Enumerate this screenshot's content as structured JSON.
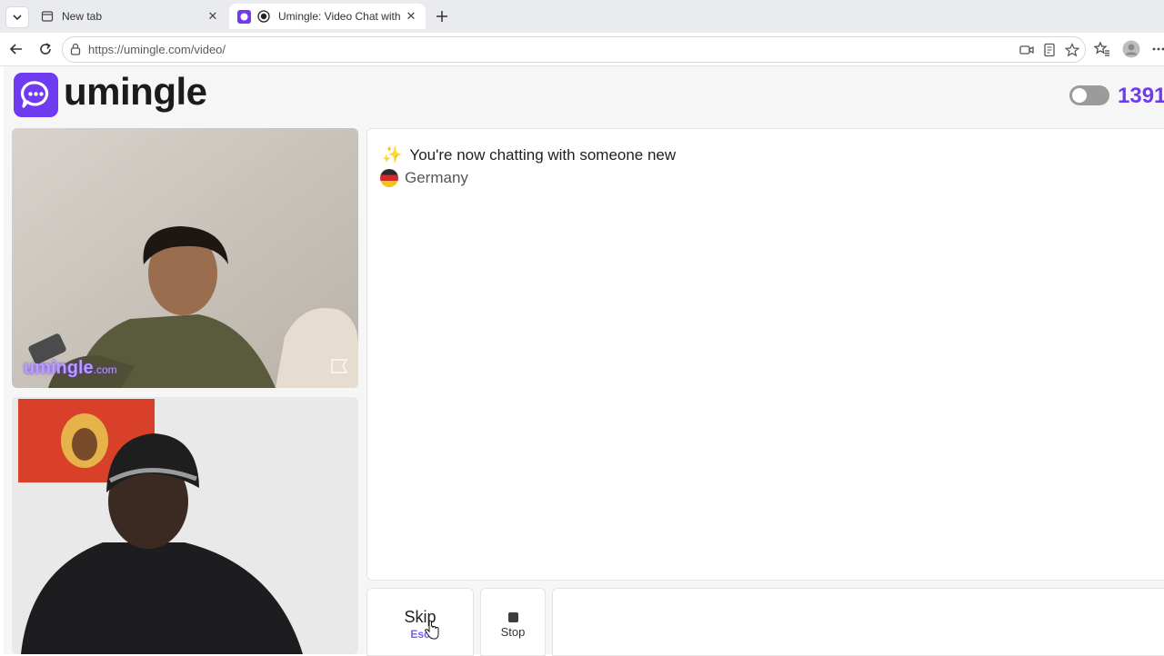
{
  "browser": {
    "tabs": [
      {
        "title": "New tab",
        "active": false
      },
      {
        "title": "Umingle: Video Chat with Stra",
        "active": true
      }
    ],
    "url": "https://umingle.com/video/",
    "icons": [
      "tab-list-icon",
      "back-icon",
      "reload-icon",
      "lock-icon",
      "video-camera-icon",
      "reader-mode-icon",
      "favorite-star-icon",
      "favorites-icon",
      "profile-icon",
      "more-icon"
    ]
  },
  "header": {
    "logo_text": "umingle",
    "online_count": "1391",
    "toggle_on": false
  },
  "videos": {
    "top_watermark": "umingle",
    "top_watermark_suffix": ".com"
  },
  "chat": {
    "status": "You're now chatting with someone new",
    "status_icon": "sparkles-icon",
    "country": "Germany"
  },
  "controls": {
    "skip_label": "Skip",
    "skip_key": "Esc",
    "stop_label": "Stop"
  },
  "colors": {
    "brand": "#6f3bf0",
    "tabbar": "#e9ebee",
    "page_bg": "#f6f6f7"
  }
}
